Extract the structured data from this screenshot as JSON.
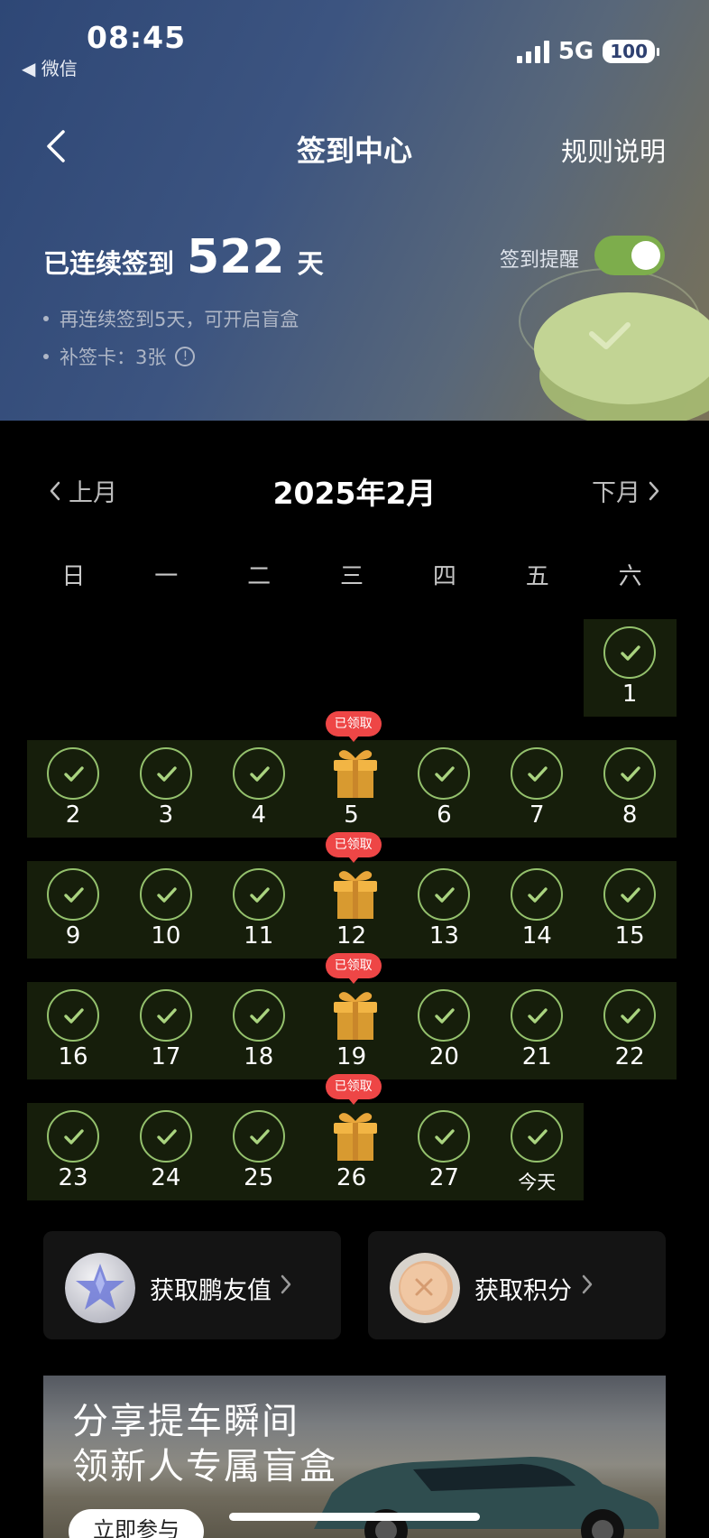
{
  "status_bar": {
    "time": "08:45",
    "back_app": "◀ 微信",
    "network": "5G",
    "battery": "100"
  },
  "nav": {
    "title": "签到中心",
    "rules": "规则说明"
  },
  "streak": {
    "prefix": "已连续签到",
    "days": "522",
    "suffix": "天"
  },
  "bullets": {
    "blind_box": "再连续签到5天，可开启盲盒",
    "makeup_cards": "补签卡：3张"
  },
  "reminder": {
    "label": "签到提醒",
    "enabled": true
  },
  "calendar": {
    "prev": "上月",
    "title": "2025年2月",
    "next": "下月",
    "weekdays": [
      "日",
      "一",
      "二",
      "三",
      "四",
      "五",
      "六"
    ],
    "days": [
      {
        "label": "1",
        "type": "checked"
      },
      {
        "label": "2",
        "type": "checked"
      },
      {
        "label": "3",
        "type": "checked"
      },
      {
        "label": "4",
        "type": "checked"
      },
      {
        "label": "5",
        "type": "gift"
      },
      {
        "label": "6",
        "type": "checked"
      },
      {
        "label": "7",
        "type": "checked"
      },
      {
        "label": "8",
        "type": "checked"
      },
      {
        "label": "9",
        "type": "checked"
      },
      {
        "label": "10",
        "type": "checked"
      },
      {
        "label": "11",
        "type": "checked"
      },
      {
        "label": "12",
        "type": "gift"
      },
      {
        "label": "13",
        "type": "checked"
      },
      {
        "label": "14",
        "type": "checked"
      },
      {
        "label": "15",
        "type": "checked"
      },
      {
        "label": "16",
        "type": "checked"
      },
      {
        "label": "17",
        "type": "checked"
      },
      {
        "label": "18",
        "type": "checked"
      },
      {
        "label": "19",
        "type": "gift"
      },
      {
        "label": "20",
        "type": "checked"
      },
      {
        "label": "21",
        "type": "checked"
      },
      {
        "label": "22",
        "type": "checked"
      },
      {
        "label": "23",
        "type": "checked"
      },
      {
        "label": "24",
        "type": "checked"
      },
      {
        "label": "25",
        "type": "checked"
      },
      {
        "label": "26",
        "type": "gift"
      },
      {
        "label": "27",
        "type": "checked"
      },
      {
        "label": "今天",
        "type": "today"
      }
    ],
    "claimed_badge": "已领取"
  },
  "cards": [
    {
      "label": "获取鹏友值",
      "icon": "star-badge-icon"
    },
    {
      "label": "获取积分",
      "icon": "coin-icon"
    }
  ],
  "banner": {
    "line1": "分享提车瞬间",
    "line2": "领新人专属盲盒",
    "button": "立即参与"
  }
}
